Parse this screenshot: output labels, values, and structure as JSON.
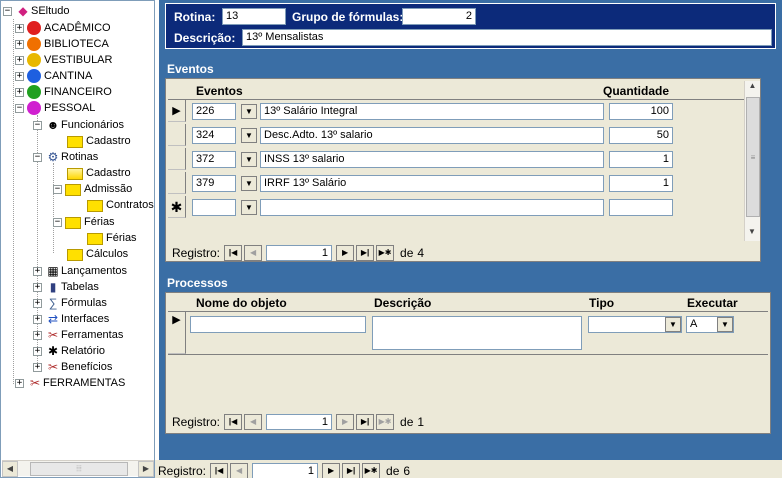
{
  "tree": {
    "items": [
      {
        "label": "SEltudo",
        "icon": "app-icon"
      },
      {
        "label": "ACADÊMICO",
        "icon": "red-ball-icon",
        "color": "#e02020"
      },
      {
        "label": "BIBLIOTECA",
        "icon": "orange-ball-icon",
        "color": "#f07000"
      },
      {
        "label": "VESTIBULAR",
        "icon": "gold-ball-icon",
        "color": "#e8b800"
      },
      {
        "label": "CANTINA",
        "icon": "blue-ball-icon",
        "color": "#1e5fe0"
      },
      {
        "label": "FINANCEIRO",
        "icon": "green-ball-icon",
        "color": "#20a020"
      },
      {
        "label": "PESSOAL",
        "icon": "magenta-ball-icon",
        "color": "#d020d0"
      },
      {
        "label": "Funcionários",
        "icon": "people-icon"
      },
      {
        "label": "Cadastro",
        "icon": "folder-icon"
      },
      {
        "label": "Rotinas",
        "icon": "tools-icon"
      },
      {
        "label": "Cadastro",
        "icon": "open-folder-icon"
      },
      {
        "label": "Admissão",
        "icon": "folder-icon"
      },
      {
        "label": "Contratos",
        "icon": "folder-icon"
      },
      {
        "label": "Férias",
        "icon": "folder-icon"
      },
      {
        "label": "Férias",
        "icon": "folder-icon"
      },
      {
        "label": "Cálculos",
        "icon": "folder-icon"
      },
      {
        "label": "Lançamentos",
        "icon": "grid-icon"
      },
      {
        "label": "Tabelas",
        "icon": "book-icon"
      },
      {
        "label": "Fórmulas",
        "icon": "formula-icon"
      },
      {
        "label": "Interfaces",
        "icon": "interface-icon"
      },
      {
        "label": "Ferramentas",
        "icon": "tools-icon"
      },
      {
        "label": "Relatório",
        "icon": "report-icon"
      },
      {
        "label": "Benefícios",
        "icon": "tools-icon"
      },
      {
        "label": "FERRAMENTAS",
        "icon": "tools-icon"
      }
    ]
  },
  "header": {
    "rotina_label": "Rotina:",
    "rotina_value": "13",
    "grupo_label": "Grupo de fórmulas:",
    "grupo_value": "2",
    "descricao_label": "Descrição:",
    "descricao_value": "13º Mensalistas"
  },
  "eventos": {
    "title": "Eventos",
    "col_eventos": "Eventos",
    "col_quantidade": "Quantidade",
    "rows": [
      {
        "code": "226",
        "desc": "13º Salário Integral",
        "qty": "100"
      },
      {
        "code": "324",
        "desc": "Desc.Adto. 13º salario",
        "qty": "50"
      },
      {
        "code": "372",
        "desc": "INSS 13º salario",
        "qty": "1"
      },
      {
        "code": "379",
        "desc": "IRRF 13º Salário",
        "qty": "1"
      }
    ],
    "nav": {
      "label": "Registro:",
      "position": "1",
      "of_label": "de",
      "total": "4"
    }
  },
  "processos": {
    "title": "Processos",
    "col_nome": "Nome do objeto",
    "col_descricao": "Descrição",
    "col_tipo": "Tipo",
    "col_executar": "Executar",
    "row": {
      "executar": "A"
    },
    "nav": {
      "label": "Registro:",
      "position": "1",
      "of_label": "de",
      "total": "1"
    }
  },
  "main_nav": {
    "label": "Registro:",
    "position": "1",
    "of_label": "de",
    "total": "6"
  }
}
